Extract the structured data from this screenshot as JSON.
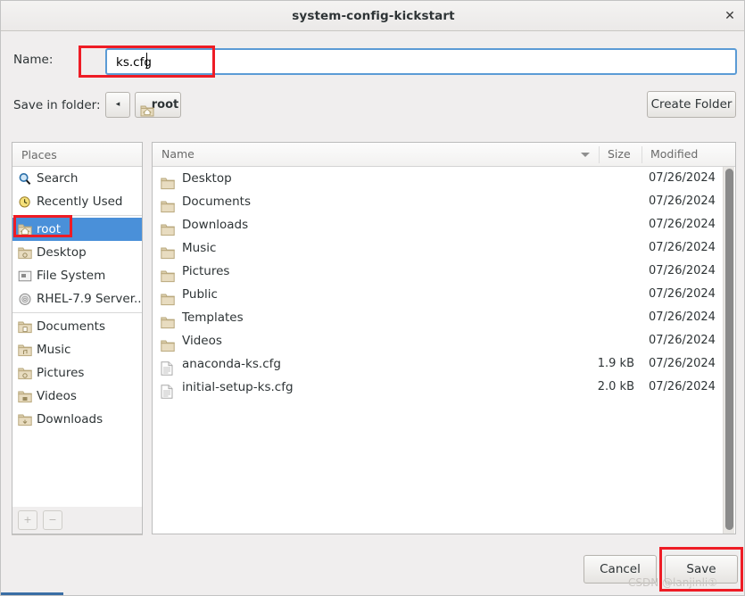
{
  "window": {
    "title": "system-config-kickstart",
    "close_label": "✕"
  },
  "name_row": {
    "label": "Name:",
    "value": "ks.cfg",
    "placeholder": ""
  },
  "folder_row": {
    "label": "Save in folder:",
    "back_label": "◂",
    "breadcrumb": "root",
    "create_folder_label": "Create Folder"
  },
  "places": {
    "header": "Places",
    "items": [
      {
        "label": "Search",
        "icon": "search-icon",
        "selected": false
      },
      {
        "label": "Recently Used",
        "icon": "clock-icon",
        "selected": false
      },
      {
        "label": "root",
        "icon": "home-folder-icon",
        "selected": true
      },
      {
        "label": "Desktop",
        "icon": "desktop-folder-icon",
        "selected": false
      },
      {
        "label": "File System",
        "icon": "drive-icon",
        "selected": false
      },
      {
        "label": "RHEL-7.9 Server...",
        "icon": "disc-icon",
        "selected": false
      },
      {
        "label": "Documents",
        "icon": "documents-folder-icon",
        "selected": false
      },
      {
        "label": "Music",
        "icon": "music-folder-icon",
        "selected": false
      },
      {
        "label": "Pictures",
        "icon": "pictures-folder-icon",
        "selected": false
      },
      {
        "label": "Videos",
        "icon": "videos-folder-icon",
        "selected": false
      },
      {
        "label": "Downloads",
        "icon": "downloads-folder-icon",
        "selected": false
      }
    ],
    "add_label": "+",
    "remove_label": "−"
  },
  "files": {
    "columns": [
      "Name",
      "Size",
      "Modified"
    ],
    "sort_column": "Name",
    "sort_direction": "descending",
    "rows": [
      {
        "name": "Desktop",
        "size": "",
        "modified": "07/26/2024",
        "icon": "folder-icon"
      },
      {
        "name": "Documents",
        "size": "",
        "modified": "07/26/2024",
        "icon": "folder-icon"
      },
      {
        "name": "Downloads",
        "size": "",
        "modified": "07/26/2024",
        "icon": "folder-icon"
      },
      {
        "name": "Music",
        "size": "",
        "modified": "07/26/2024",
        "icon": "folder-icon"
      },
      {
        "name": "Pictures",
        "size": "",
        "modified": "07/26/2024",
        "icon": "folder-icon"
      },
      {
        "name": "Public",
        "size": "",
        "modified": "07/26/2024",
        "icon": "folder-icon"
      },
      {
        "name": "Templates",
        "size": "",
        "modified": "07/26/2024",
        "icon": "folder-icon"
      },
      {
        "name": "Videos",
        "size": "",
        "modified": "07/26/2024",
        "icon": "folder-icon"
      },
      {
        "name": "anaconda-ks.cfg",
        "size": "1.9 kB",
        "modified": "07/26/2024",
        "icon": "text-file-icon"
      },
      {
        "name": "initial-setup-ks.cfg",
        "size": "2.0 kB",
        "modified": "07/26/2024",
        "icon": "text-file-icon"
      }
    ]
  },
  "actions": {
    "cancel_label": "Cancel",
    "save_label": "Save"
  },
  "watermark": {
    "text": "CSDN @lanjinli①"
  },
  "colors": {
    "selection_blue": "#4a90d9",
    "focus_blue": "#5b9bd5",
    "highlight_red": "#ee1c25",
    "window_bg": "#f0eeee",
    "pane_bg": "#ffffff"
  }
}
